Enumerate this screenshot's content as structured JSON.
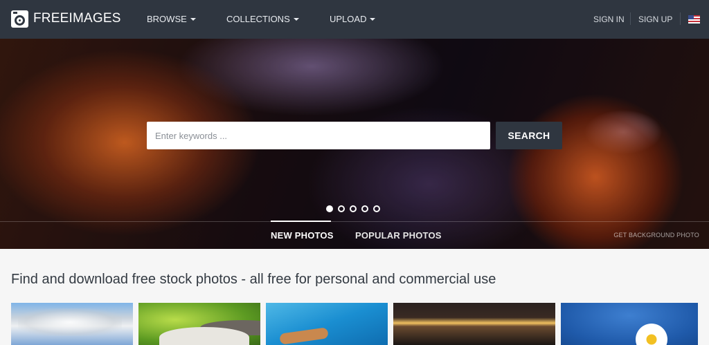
{
  "nav": {
    "brand": "FREEIMAGES",
    "menu": [
      {
        "label": "BROWSE"
      },
      {
        "label": "COLLECTIONS"
      },
      {
        "label": "UPLOAD"
      }
    ],
    "sign_in": "SIGN IN",
    "sign_up": "SIGN UP",
    "language_icon": "us-flag-icon"
  },
  "hero": {
    "search": {
      "placeholder": "Enter keywords ...",
      "value": "",
      "button_label": "SEARCH"
    },
    "slides": {
      "count": 5,
      "active_index": 0
    },
    "tabs": [
      {
        "label": "NEW PHOTOS",
        "active": true
      },
      {
        "label": "POPULAR PHOTOS",
        "active": false
      }
    ],
    "background_link": "GET BACKGROUND PHOTO"
  },
  "main": {
    "tagline": "Find and download free stock photos - all free for personal and commercial use"
  },
  "colors": {
    "navbar": "#2f3640",
    "search_button": "#2f3640",
    "page_background": "#f6f6f6"
  }
}
